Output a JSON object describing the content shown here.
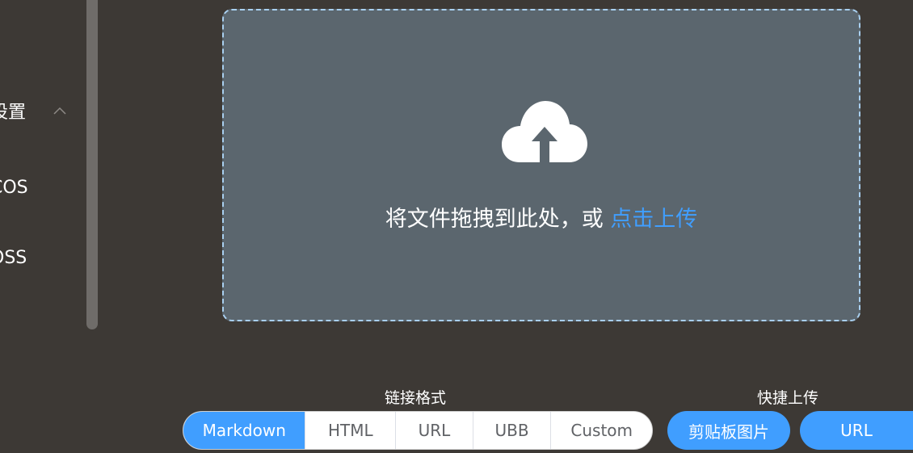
{
  "sidebar": {
    "items": [
      {
        "label": "设置",
        "expanded": true
      },
      {
        "label": "COS"
      },
      {
        "label": "OSS"
      }
    ]
  },
  "dropzone": {
    "text": "将文件拖拽到此处，或",
    "link": "点击上传",
    "icon": "cloud-upload-icon"
  },
  "link_format": {
    "title": "链接格式",
    "options": [
      "Markdown",
      "HTML",
      "URL",
      "UBB",
      "Custom"
    ],
    "selected": "Markdown"
  },
  "quick_upload": {
    "title": "快捷上传",
    "clipboard_label": "剪贴板图片",
    "url_label": "URL"
  },
  "colors": {
    "background": "#3d3935",
    "dropzone_bg": "#5b666e",
    "accent": "#409eff"
  }
}
